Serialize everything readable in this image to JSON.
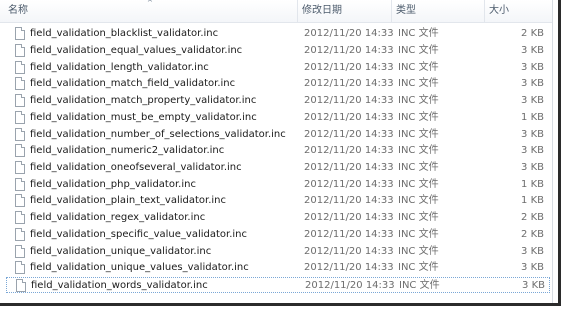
{
  "header": {
    "name": "名称",
    "date": "修改日期",
    "type": "类型",
    "size": "大小",
    "sort_caret": "^"
  },
  "files": [
    {
      "name": "field_validation_blacklist_validator.inc",
      "date": "2012/11/20 14:33",
      "type": "INC 文件",
      "size": "2 KB"
    },
    {
      "name": "field_validation_equal_values_validator.inc",
      "date": "2012/11/20 14:33",
      "type": "INC 文件",
      "size": "3 KB"
    },
    {
      "name": "field_validation_length_validator.inc",
      "date": "2012/11/20 14:33",
      "type": "INC 文件",
      "size": "3 KB"
    },
    {
      "name": "field_validation_match_field_validator.inc",
      "date": "2012/11/20 14:33",
      "type": "INC 文件",
      "size": "3 KB"
    },
    {
      "name": "field_validation_match_property_validator.inc",
      "date": "2012/11/20 14:33",
      "type": "INC 文件",
      "size": "3 KB"
    },
    {
      "name": "field_validation_must_be_empty_validator.inc",
      "date": "2012/11/20 14:33",
      "type": "INC 文件",
      "size": "1 KB"
    },
    {
      "name": "field_validation_number_of_selections_validator.inc",
      "date": "2012/11/20 14:33",
      "type": "INC 文件",
      "size": "3 KB"
    },
    {
      "name": "field_validation_numeric2_validator.inc",
      "date": "2012/11/20 14:33",
      "type": "INC 文件",
      "size": "3 KB"
    },
    {
      "name": "field_validation_oneofseveral_validator.inc",
      "date": "2012/11/20 14:33",
      "type": "INC 文件",
      "size": "3 KB"
    },
    {
      "name": "field_validation_php_validator.inc",
      "date": "2012/11/20 14:33",
      "type": "INC 文件",
      "size": "1 KB"
    },
    {
      "name": "field_validation_plain_text_validator.inc",
      "date": "2012/11/20 14:33",
      "type": "INC 文件",
      "size": "1 KB"
    },
    {
      "name": "field_validation_regex_validator.inc",
      "date": "2012/11/20 14:33",
      "type": "INC 文件",
      "size": "2 KB"
    },
    {
      "name": "field_validation_specific_value_validator.inc",
      "date": "2012/11/20 14:33",
      "type": "INC 文件",
      "size": "2 KB"
    },
    {
      "name": "field_validation_unique_validator.inc",
      "date": "2012/11/20 14:33",
      "type": "INC 文件",
      "size": "3 KB"
    },
    {
      "name": "field_validation_unique_values_validator.inc",
      "date": "2012/11/20 14:33",
      "type": "INC 文件",
      "size": "3 KB"
    },
    {
      "name": "field_validation_words_validator.inc",
      "date": "2012/11/20 14:33",
      "type": "INC 文件",
      "size": "3 KB"
    }
  ],
  "icons": {
    "file": "file-icon"
  }
}
